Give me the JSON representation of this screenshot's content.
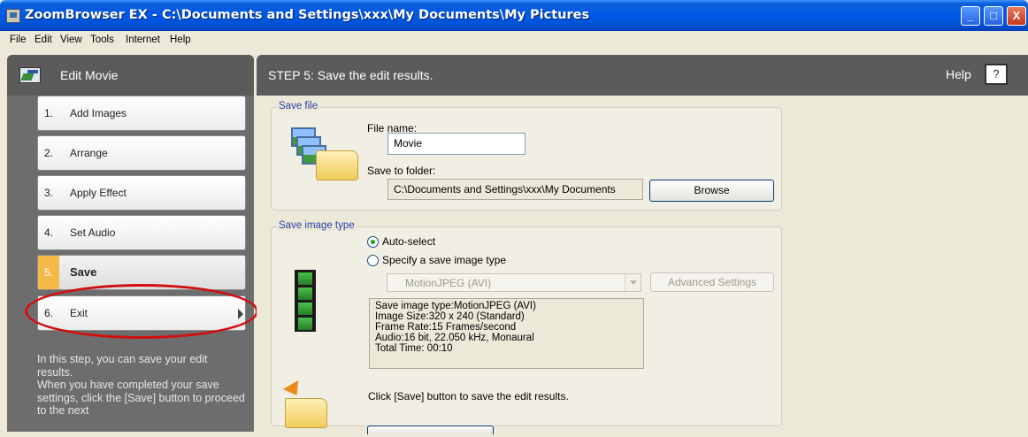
{
  "window": {
    "title": "ZoomBrowser EX  -  C:\\Documents and Settings\\xxx\\My Documents\\My Pictures",
    "controls": [
      "_",
      "□",
      "X"
    ]
  },
  "menu": [
    "File",
    "Edit",
    "View",
    "Tools",
    "Internet",
    "Help"
  ],
  "left_panel": {
    "title": "Edit Movie",
    "steps": [
      {
        "num": "1.",
        "label": "Add Images"
      },
      {
        "num": "2.",
        "label": "Arrange"
      },
      {
        "num": "3.",
        "label": "Apply Effect"
      },
      {
        "num": "4.",
        "label": "Set Audio"
      },
      {
        "num": "5.",
        "label": "Save"
      },
      {
        "num": "6.",
        "label": "Exit"
      }
    ],
    "active_step": "Save",
    "hint": "In this step, you can save your edit results.\nWhen you have completed your save settings, click the [Save] button to proceed to the next"
  },
  "right_panel": {
    "title": "STEP 5: Save the edit results.",
    "help_label": "Help",
    "help_button": "?",
    "save_file": {
      "group_title": "Save file",
      "file_name_label": "File name:",
      "file_name_value": "Movie",
      "folder_label": "Save to folder:",
      "folder_value": "C:\\Documents and Settings\\xxx\\My Documents",
      "browse_button": "Browse"
    },
    "save_image_type": {
      "group_title": "Save image type",
      "radio_auto": "Auto-select",
      "radio_specify": "Specify a save image type",
      "selected": "Auto-select",
      "format_select": "MotionJPEG (AVI)",
      "advanced_button": "Advanced Settings",
      "info_lines": [
        "Save image type:MotionJPEG (AVI)",
        "Image Size:320 x 240 (Standard)",
        "Frame Rate:15 Frames/second",
        "Audio:16 bit, 22.050 kHz, Monaural",
        "Total Time: 00:10"
      ]
    },
    "save_instruction": "Click [Save] button to save the edit results."
  }
}
